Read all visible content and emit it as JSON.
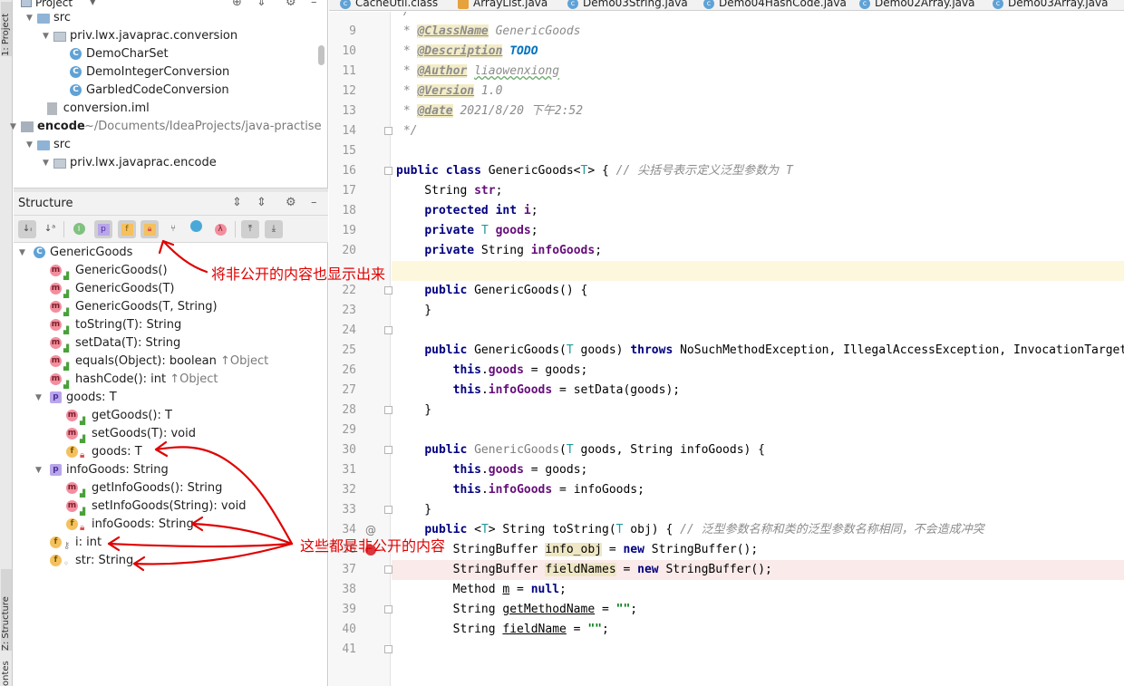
{
  "sidebar_strip": {
    "project_label": "1: Project",
    "structure_label": "Z: Structure",
    "favorites_label": "ontes"
  },
  "project_panel": {
    "title": "Project",
    "tree": [
      {
        "label": "src",
        "indent": 1,
        "kind": "folder",
        "open": true
      },
      {
        "label": "priv.lwx.javaprac.conversion",
        "indent": 2,
        "kind": "package",
        "open": true
      },
      {
        "label": "DemoCharSet",
        "indent": 3,
        "kind": "class"
      },
      {
        "label": "DemoIntegerConversion",
        "indent": 3,
        "kind": "class"
      },
      {
        "label": "GarbledCodeConversion",
        "indent": 3,
        "kind": "class"
      },
      {
        "label": "conversion.iml",
        "indent": 1.6,
        "kind": "file"
      },
      {
        "label": "encode",
        "suffix": "~/Documents/IdeaProjects/java-practise",
        "indent": 0,
        "kind": "module",
        "open": true
      },
      {
        "label": "src",
        "indent": 1,
        "kind": "folder",
        "open": true
      },
      {
        "label": "priv.lwx.javaprac.encode",
        "indent": 2,
        "kind": "package",
        "open": true
      }
    ]
  },
  "structure_panel": {
    "title": "Structure",
    "tree": [
      {
        "label": "GenericGoods",
        "kind": "class",
        "indent": 0,
        "open": true
      },
      {
        "label": "GenericGoods()",
        "kind": "m",
        "vis": "public",
        "indent": 1
      },
      {
        "label": "GenericGoods(T)",
        "kind": "m",
        "vis": "public",
        "indent": 1
      },
      {
        "label": "GenericGoods(T, String)",
        "kind": "m",
        "vis": "public",
        "indent": 1
      },
      {
        "label": "toString(T): String",
        "kind": "m",
        "vis": "public",
        "indent": 1
      },
      {
        "label": "setData(T): String",
        "kind": "m",
        "vis": "public",
        "indent": 1
      },
      {
        "label": "equals(Object): boolean",
        "suffix": "↑Object",
        "kind": "m",
        "vis": "public",
        "indent": 1
      },
      {
        "label": "hashCode(): int",
        "suffix": "↑Object",
        "kind": "m",
        "vis": "public",
        "indent": 1
      },
      {
        "label": "goods: T",
        "kind": "p",
        "indent": 1,
        "open": true
      },
      {
        "label": "getGoods(): T",
        "kind": "m",
        "vis": "public",
        "indent": 2
      },
      {
        "label": "setGoods(T): void",
        "kind": "m",
        "vis": "public",
        "indent": 2
      },
      {
        "label": "goods: T",
        "kind": "f",
        "vis": "private",
        "indent": 2
      },
      {
        "label": "infoGoods: String",
        "kind": "p",
        "indent": 1,
        "open": true
      },
      {
        "label": "getInfoGoods(): String",
        "kind": "m",
        "vis": "public",
        "indent": 2
      },
      {
        "label": "setInfoGoods(String): void",
        "kind": "m",
        "vis": "public",
        "indent": 2
      },
      {
        "label": "infoGoods: String",
        "kind": "f",
        "vis": "private",
        "indent": 2
      },
      {
        "label": "i: int",
        "kind": "f",
        "vis": "protected",
        "indent": 1
      },
      {
        "label": "str: String",
        "kind": "f",
        "vis": "package",
        "indent": 1
      }
    ]
  },
  "annotations": {
    "show_nonpublic": "将非公开的内容也显示出来",
    "these_nonpublic": "这些都是非公开的内容"
  },
  "tabs": [
    {
      "label": "CacheUtil.class",
      "icon": "c"
    },
    {
      "label": "ArrayList.java",
      "icon": "j"
    },
    {
      "label": "Demo03String.java",
      "icon": "c"
    },
    {
      "label": "Demo04HashCode.java",
      "icon": "c"
    },
    {
      "label": "Demo02Array.java",
      "icon": "c"
    },
    {
      "label": "Demo03Array.java",
      "icon": "c"
    }
  ],
  "editor": {
    "line_numbers": [
      "9",
      "10",
      "11",
      "12",
      "13",
      "14",
      "15",
      "16",
      "17",
      "18",
      "19",
      "20",
      "",
      "22",
      "23",
      "24",
      "25",
      "26",
      "27",
      "28",
      "29",
      "30",
      "31",
      "32",
      "33",
      "34",
      "36",
      "37",
      "38",
      "39",
      "40",
      "41"
    ],
    "lines": {
      "l9_tag": "@ClassName",
      "l9_val": "GenericGoods",
      "l10_tag": "@Description",
      "l10_val": "TODO",
      "l11_tag": "@Author",
      "l11_val": "liaowenxiong",
      "l12_tag": "@Version",
      "l12_val": "1.0",
      "l13_tag": "@date",
      "l13_val": "2021/8/20 下午2:52",
      "l14": "*/",
      "l16_comment": "// 尖括号表示定义泛型参数为 T",
      "l34_comment": "// 泛型参数名称和类的泛型参数名称相同，不会造成冲突",
      "l35_text": "StringBuffer info_obj = new StringBuffer();"
    }
  },
  "colors": {
    "accent_red": "#e00000",
    "breakpoint": "#d9363e"
  }
}
